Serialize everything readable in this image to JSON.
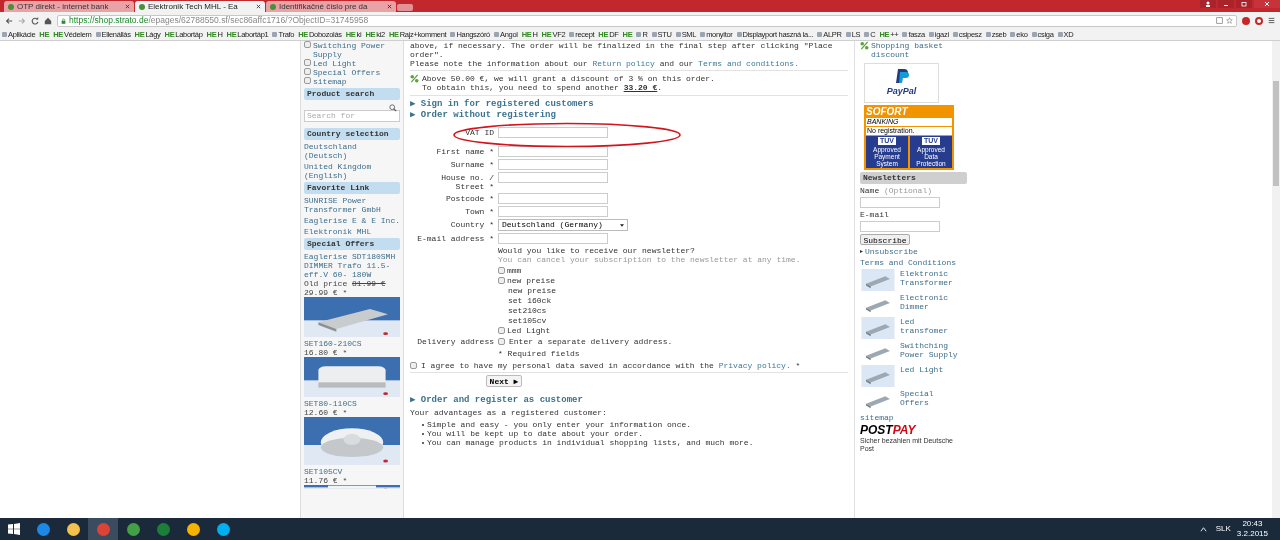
{
  "browser": {
    "tabs": [
      {
        "title": "OTP direkt - internet bank",
        "selected": false
      },
      {
        "title": "Elektronik Tech MHL - Ea",
        "selected": true
      },
      {
        "title": "Identifikačné číslo pre da",
        "selected": false
      }
    ],
    "url_host": "https://shop.strato.de",
    "url_path": "/epages/62788550.sf/sec86affc1716/?ObjectID=31745958",
    "bookmarks": [
      {
        "label": "Aplikácie"
      },
      {
        "badge": "HE"
      },
      {
        "badge": "HE",
        "label": "Védelem"
      },
      {
        "label": "Ellenállás"
      },
      {
        "badge": "HE",
        "label": "Lágy"
      },
      {
        "badge": "HE",
        "label": "Labortáp"
      },
      {
        "badge": "HE",
        "label": "H"
      },
      {
        "badge": "HE",
        "label": "Labortáp1"
      },
      {
        "label": "Trafo"
      },
      {
        "badge": "HE",
        "label": "Dobozolás"
      },
      {
        "badge": "HE",
        "label": "ki"
      },
      {
        "badge": "HE",
        "label": "ki2"
      },
      {
        "badge": "HE",
        "label": "Rajz+komment"
      },
      {
        "label": "Hangszóró"
      },
      {
        "label": "Angol"
      },
      {
        "badge": "HE",
        "label": "H"
      },
      {
        "badge": "HE",
        "label": "VF2"
      },
      {
        "label": "recept"
      },
      {
        "badge": "HE",
        "label": "DF"
      },
      {
        "badge": "HE"
      },
      {
        "label": "R"
      },
      {
        "label": "STU"
      },
      {
        "label": "SML"
      },
      {
        "label": "monyitor"
      },
      {
        "label": "Displayport haszná la..."
      },
      {
        "label": "ALPR"
      },
      {
        "label": "LS"
      },
      {
        "label": "C"
      },
      {
        "badge": "HE",
        "label": "++"
      },
      {
        "label": "fasza"
      },
      {
        "label": "igazi"
      },
      {
        "label": "csipesz"
      },
      {
        "label": "zseb"
      },
      {
        "label": "eko"
      },
      {
        "label": "csiga"
      },
      {
        "label": "XD"
      }
    ]
  },
  "left": {
    "nav": [
      "Switching Power Supply",
      "Led Light",
      "Special Offers",
      "sitemap"
    ],
    "search": {
      "title": "Product search",
      "placeholder": "Search for"
    },
    "country": {
      "title": "Country selection",
      "links": [
        "Deutschland (Deutsch)",
        "United Kingdom (English)"
      ]
    },
    "favorites": {
      "title": "Favorite Link",
      "links": [
        "SUNRISE Power Transformer GmbH",
        "Eaglerise E & E Inc.",
        "Elektronik MHL"
      ]
    },
    "offers": {
      "title": "Special Offers",
      "items": [
        {
          "name": "Eaglerise SDT180SMH DIMMER Trafo 11.5-eff.V 60- 180W",
          "old_label": "Old price",
          "old_price": "81.99 €",
          "price": "29.99 € *"
        },
        {
          "name": "SET160-210CS",
          "price": "16.80 € *"
        },
        {
          "name": "SET80-110CS",
          "price": "12.60 € *"
        },
        {
          "name": "SET105CV",
          "price": "11.76 € *"
        }
      ]
    }
  },
  "main": {
    "intro": [
      "above, if necessary. The order will be finalized in the final step after clicking \"Place order\"."
    ],
    "note": {
      "before": "Please note the information about our",
      "link1": "Return policy",
      "middle": "and our",
      "link2": "Terms and conditions."
    },
    "discount": {
      "line1": "Above 50.00 €, we will grant a discount of 3 % on this order.",
      "line2": "To obtain this, you need to spend another",
      "amount": "33.20 €",
      "end": "."
    },
    "sign_in": "▶ Sign in for registered customers",
    "order_without": "▶ Order without registering",
    "fields": [
      {
        "kind": "text",
        "label": "VAT ID"
      },
      {
        "kind": "text",
        "label": "First name *"
      },
      {
        "kind": "text",
        "label": "Surname *"
      },
      {
        "kind": "text",
        "label": "House no. / Street *"
      },
      {
        "kind": "text",
        "label": "Postcode *"
      },
      {
        "kind": "text",
        "label": "Town *"
      },
      {
        "kind": "select",
        "label": "Country *",
        "value": "Deutschland (Germany)"
      },
      {
        "kind": "text",
        "label": "E-mail address *"
      }
    ],
    "newsletter_question": "Would you like to receive our newsletter?",
    "newsletter_hint": "You can cancel your subscription to the newsletter at any time.",
    "newsletter_options": [
      {
        "kind": "checkbox",
        "label": "mmm",
        "checked": false
      },
      {
        "kind": "checkbox",
        "label": "new preise",
        "checked": false
      },
      {
        "kind": "text",
        "label": "new preise"
      },
      {
        "kind": "text",
        "label": "set 160ck"
      },
      {
        "kind": "text",
        "label": "set210cs"
      },
      {
        "kind": "text",
        "label": "set105cv"
      },
      {
        "kind": "checkbox",
        "label": "Led Light",
        "checked": false
      }
    ],
    "delivery": {
      "label": "Delivery address",
      "option": "Enter a separate delivery address.",
      "checked": false
    },
    "required": "* Required fields",
    "agree": {
      "before": "I agree to have my personal data saved in accordance with the",
      "link": "Privacy policy.",
      "after": "*",
      "checked": false
    },
    "next": "Next ▶",
    "register": "▶ Order and register as customer",
    "advantages": "Your advantages as a registered customer:",
    "bullets": [
      "Simple and easy - you only enter your information once.",
      "You will be kept up to date about your order.",
      "You can manage products in individual shopping lists, and much more."
    ]
  },
  "right": {
    "basket_discount": "Shopping basket discount",
    "paypal": "PayPal",
    "sofort": {
      "title": "SOFORT",
      "sub": "BANKING",
      "note": "No registration.",
      "seals": [
        {
          "name": "TÜV",
          "text": "Approved Payment System"
        },
        {
          "name": "TÜV",
          "text": "Approved Data Protection"
        }
      ]
    },
    "newsletter": {
      "title": "Newsletters",
      "name_label": "Name",
      "name_hint": "(Optional)",
      "email_label": "E-mail",
      "button": "Subscribe",
      "unsubscribe": "Unsubscribe"
    },
    "terms": "Terms and Conditions",
    "categories": [
      "Elektronic Transformer",
      "Electronic Dimmer",
      "Led transfomer",
      "Swithching Power Supply",
      "Led Light",
      "Special Offers"
    ],
    "sitemap": "sitemap",
    "postpay": {
      "post": "POST",
      "pay": "PAY",
      "tagline": "Sicher bezahlen mit Deutsche Post"
    }
  },
  "taskbar": {
    "language": "SLK",
    "time": "20:43",
    "date": "3.2.2015"
  }
}
